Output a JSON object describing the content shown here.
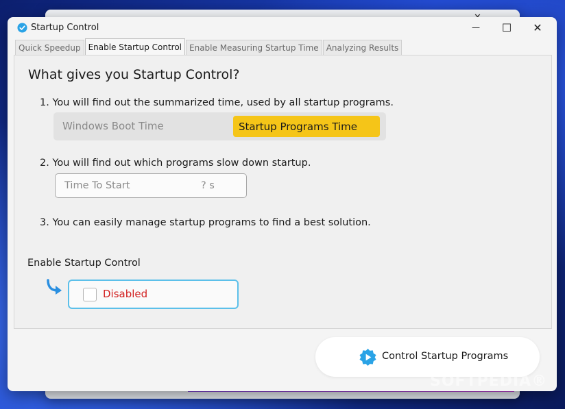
{
  "window": {
    "title": "Startup Control",
    "minimize_glyph": "—",
    "maximize_glyph": "☐",
    "close_glyph": "✕"
  },
  "tabs": [
    {
      "label": "Quick Speedup",
      "active": false
    },
    {
      "label": "Enable Startup Control",
      "active": true
    },
    {
      "label": "Enable Measuring Startup Time",
      "active": false
    },
    {
      "label": "Analyzing Results",
      "active": false
    }
  ],
  "content": {
    "heading": "What gives you Startup Control?",
    "item1": "1. You will find out the summarized time, used by all startup programs.",
    "segment_left": "Windows Boot Time",
    "segment_right": "Startup Programs Time",
    "item2": "2. You will find out which programs slow down startup.",
    "time_to_start_label": "Time To Start",
    "time_to_start_value": "? s",
    "item3": "3. You can easily manage startup programs to find a best solution."
  },
  "toggle": {
    "section_label": "Enable Startup Control",
    "state_text": "Disabled",
    "checked": false
  },
  "cta": {
    "label": "Control Startup Programs"
  },
  "watermark": "SOFTPEDIA®",
  "colors": {
    "accent_yellow": "#f5c518",
    "toggle_border": "#5cc0ea",
    "disabled_red": "#d21f1f",
    "icon_blue": "#2aa3e6"
  },
  "icons": {
    "app": "shield-check-icon",
    "arrow": "curved-arrow-icon",
    "cta": "play-gear-icon"
  }
}
